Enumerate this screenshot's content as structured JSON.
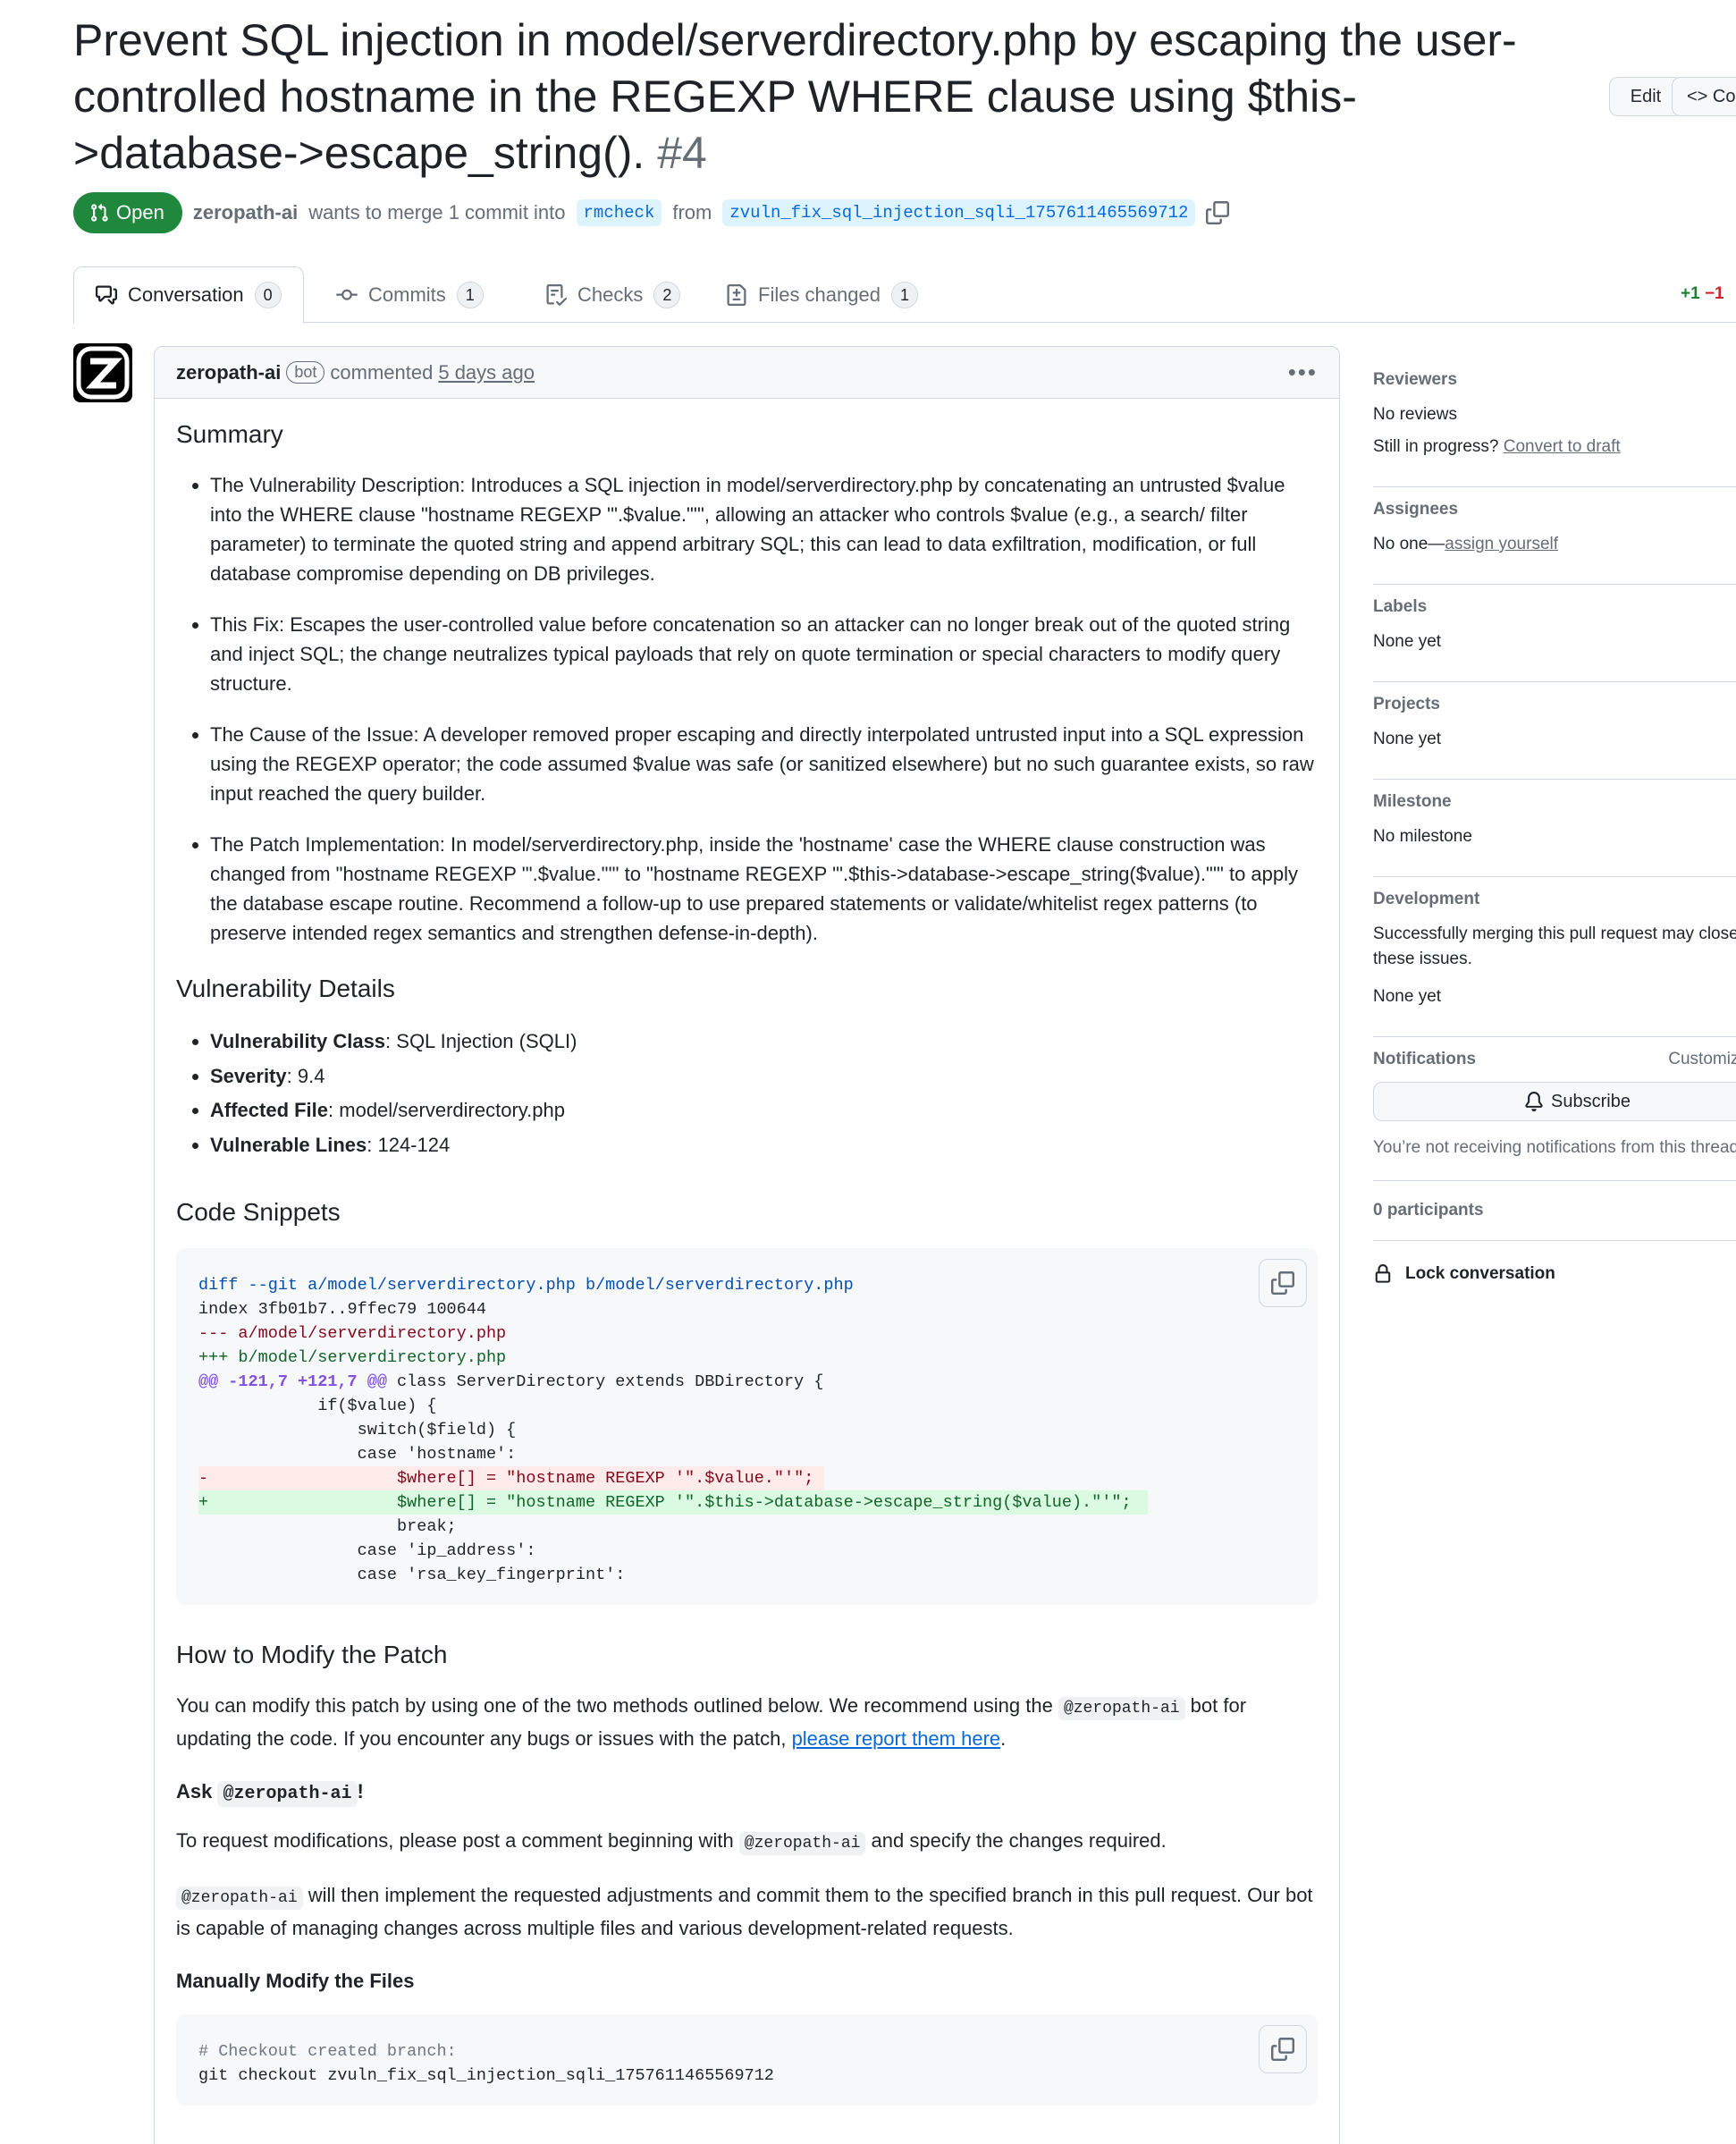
{
  "pr": {
    "title": "Prevent SQL injection in model/serverdirectory.php by escaping the user-controlled hostname in the REGEXP WHERE clause using $this->database->escape_string().",
    "number": "#4",
    "edit_label": "Edit",
    "code_label": "Code",
    "state": "Open",
    "author": "zeropath-ai",
    "merge_text": "wants to merge 1 commit into",
    "base_branch": "rmcheck",
    "from_text": "from",
    "head_branch": "zvuln_fix_sql_injection_sqli_1757611465569712"
  },
  "tabs": [
    {
      "label": "Conversation",
      "count": "0"
    },
    {
      "label": "Commits",
      "count": "1"
    },
    {
      "label": "Checks",
      "count": "2"
    },
    {
      "label": "Files changed",
      "count": "1"
    }
  ],
  "diffstat": {
    "add": "+1",
    "del": "−1"
  },
  "comment": {
    "author": "zeropath-ai",
    "bot_label": "bot",
    "action": "commented",
    "time": "5 days ago",
    "summary_heading": "Summary",
    "summary_items": [
      "The Vulnerability Description: Introduces a SQL injection in model/serverdirectory.php by concatenating an untrusted $value into the WHERE clause \"hostname REGEXP '\".$value.\"'\", allowing an attacker who controls $value (e.g., a search/ filter parameter) to terminate the quoted string and append arbitrary SQL; this can lead to data exfiltration, modification, or full database compromise depending on DB privileges.",
      "This Fix: Escapes the user-controlled value before concatenation so an attacker can no longer break out of the quoted string and inject SQL; the change neutralizes typical payloads that rely on quote termination or special characters to modify query structure.",
      "The Cause of the Issue: A developer removed proper escaping and directly interpolated untrusted input into a SQL expression using the REGEXP operator; the code assumed $value was safe (or sanitized elsewhere) but no such guarantee exists, so raw input reached the query builder.",
      "The Patch Implementation: In model/serverdirectory.php, inside the 'hostname' case the WHERE clause construction was changed from \"hostname REGEXP '\".$value.\"'\" to \"hostname REGEXP '\".$this->database->escape_string($value).\"'\" to apply the database escape routine. Recommend a follow-up to use prepared statements or validate/whitelist regex patterns (to preserve intended regex semantics and strengthen defense-in-depth)."
    ],
    "details_heading": "Vulnerability Details",
    "details": [
      {
        "label": "Vulnerability Class",
        "value": ": SQL Injection (SQLI)"
      },
      {
        "label": "Severity",
        "value": ": 9.4"
      },
      {
        "label": "Affected File",
        "value": ": model/serverdirectory.php"
      },
      {
        "label": "Vulnerable Lines",
        "value": ": 124-124"
      }
    ],
    "snippets_heading": "Code Snippets",
    "diff": {
      "l1": "diff --git a/model/serverdirectory.php b/model/serverdirectory.php",
      "l2": "index 3fb01b7..9ffec79 100644",
      "l3": "--- a/model/serverdirectory.php",
      "l4": "+++ b/model/serverdirectory.php",
      "l5_hunk": "@@ -121,7 +121,7 @@",
      "l5_rest": " class ServerDirectory extends DBDirectory {",
      "l6": "            if($value) {",
      "l7": "                switch($field) {",
      "l8": "                case 'hostname':",
      "l9": "-                   $where[] = \"hostname REGEXP '\".$value.\"'\";",
      "l10": "+                   $where[] = \"hostname REGEXP '\".$this->database->escape_string($value).\"'\";",
      "l11": "                    break;",
      "l12": "                case 'ip_address':",
      "l13": "                case 'rsa_key_fingerprint':"
    },
    "modify_heading": "How to Modify the Patch",
    "modify_p1_a": "You can modify this patch by using one of the two methods outlined below. We recommend using the ",
    "modify_code": "@zeropath-ai",
    "modify_p1_b": " bot for updating the code. If you encounter any bugs or issues with the patch, ",
    "modify_link": "please report them here",
    "modify_p1_c": ".",
    "ask_prefix": "Ask ",
    "ask_code": "@zeropath-ai",
    "ask_suffix": "!",
    "req_a": "To request modifications, please post a comment beginning with ",
    "req_code": "@zeropath-ai",
    "req_b": " and specify the changes required.",
    "impl_code": "@zeropath-ai",
    "impl_text": " will then implement the requested adjustments and commit them to the specified branch in this pull request. Our bot is capable of managing changes across multiple files and various development-related requests.",
    "manual_heading": "Manually Modify the Files",
    "checkout_comment": "# Checkout created branch:",
    "checkout_cmd": "git checkout zvuln_fix_sql_injection_sqli_1757611465569712"
  },
  "sidebar": {
    "reviewers": {
      "heading": "Reviewers",
      "value": "No reviews",
      "progress": "Still in progress?",
      "draft_link": "Convert to draft"
    },
    "assignees": {
      "heading": "Assignees",
      "value": "No one—",
      "link": "assign yourself"
    },
    "labels": {
      "heading": "Labels",
      "value": "None yet"
    },
    "projects": {
      "heading": "Projects",
      "value": "None yet"
    },
    "milestone": {
      "heading": "Milestone",
      "value": "No milestone"
    },
    "development": {
      "heading": "Development",
      "text": "Successfully merging this pull request may close these issues.",
      "value": "None yet"
    },
    "notifications": {
      "heading": "Notifications",
      "customize": "Customize",
      "subscribe": "Subscribe",
      "note": "You’re not receiving notifications from this thread."
    },
    "participants": "0 participants",
    "lock": "Lock conversation"
  },
  "colors": {
    "open_green": "#1f883d",
    "link_blue": "#0969da",
    "add_bg": "#dafbe1",
    "del_bg": "#ffebe9"
  }
}
